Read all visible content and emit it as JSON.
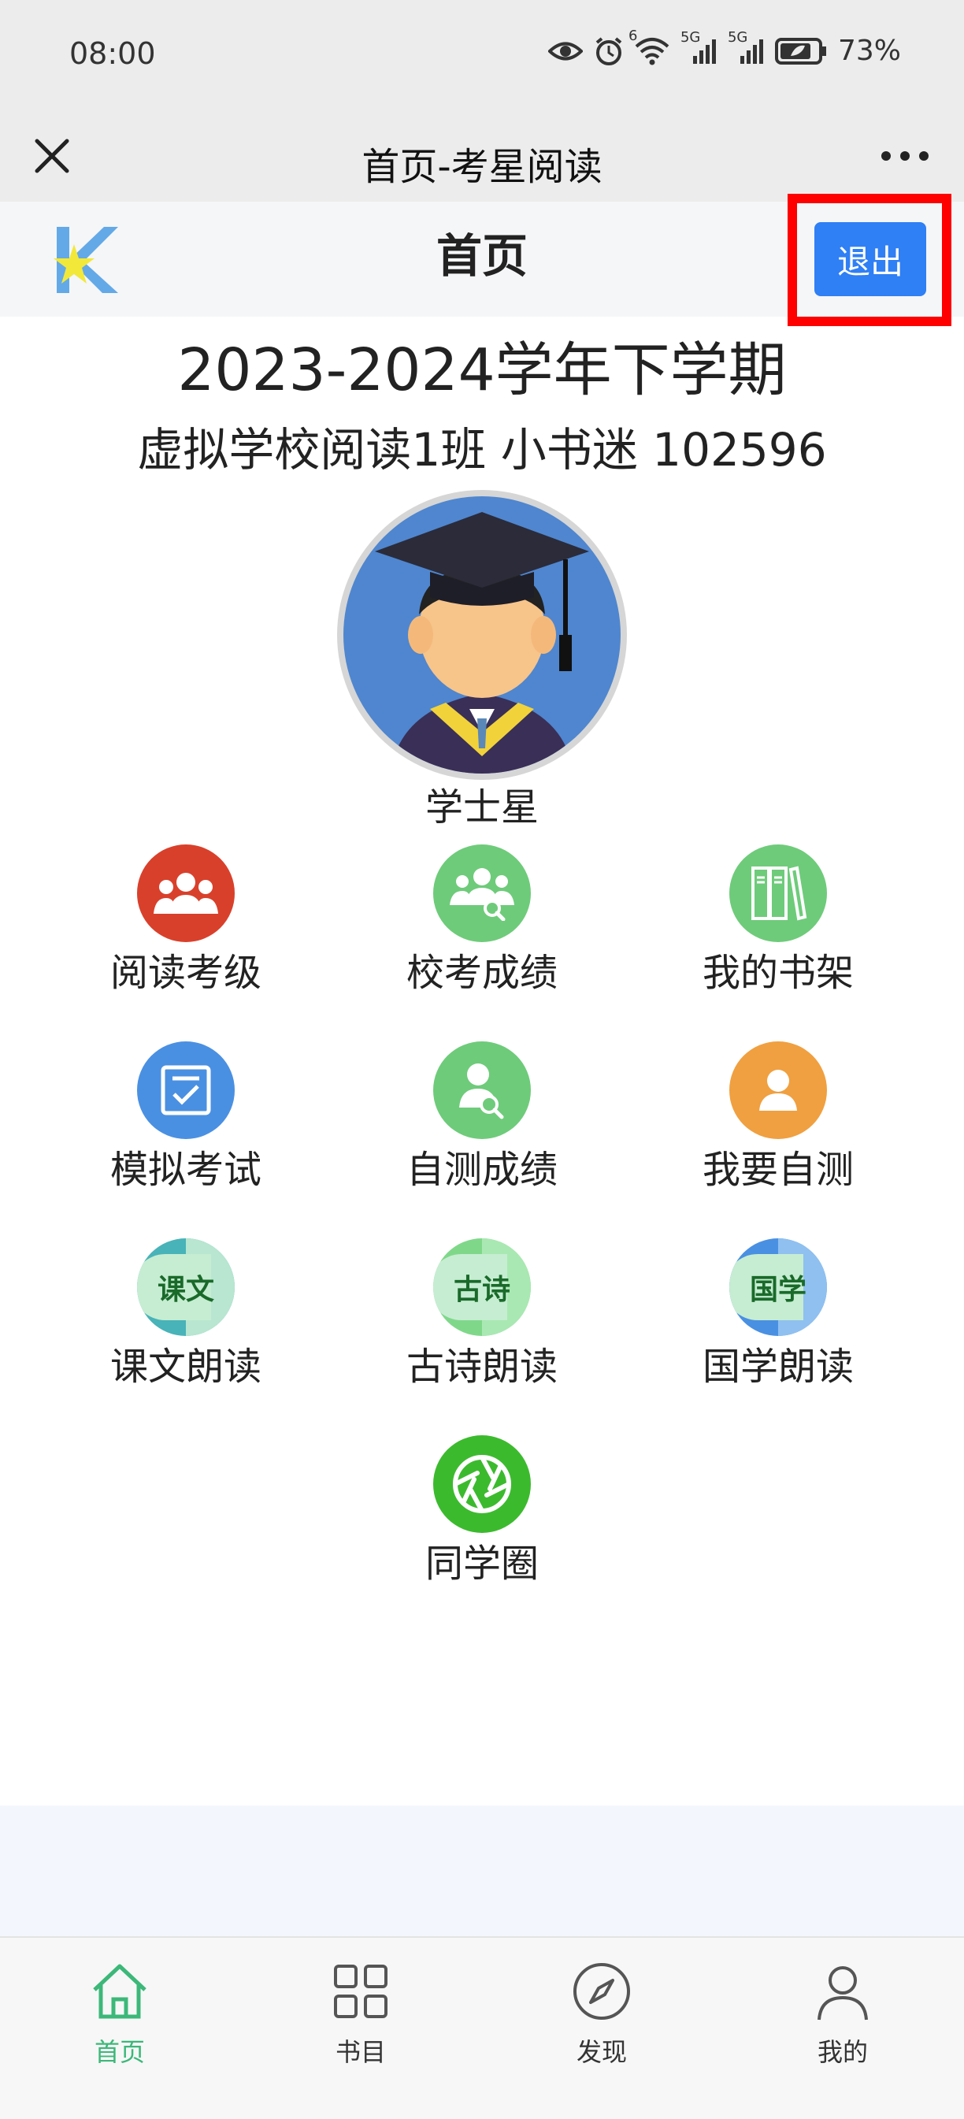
{
  "status": {
    "time": "08:00",
    "battery": "73%",
    "net1": "5G",
    "net2": "5G",
    "wifi_badge": "6"
  },
  "wechat": {
    "title": "首页-考星阅读"
  },
  "header": {
    "title": "首页",
    "logout_label": "退出",
    "logo_letter": "K"
  },
  "term": "2023-2024学年下学期",
  "class_info": "虚拟学校阅读1班 小书迷 102596",
  "rank_label": "学士星",
  "grid": [
    {
      "label": "阅读考级",
      "icon": "group-icon",
      "color": "#d9402b"
    },
    {
      "label": "校考成绩",
      "icon": "group-search-icon",
      "color": "#6ecb7a"
    },
    {
      "label": "我的书架",
      "icon": "bookshelf-icon",
      "color": "#6ecb7a"
    },
    {
      "label": "模拟考试",
      "icon": "checklist-icon",
      "color": "#4a90e2"
    },
    {
      "label": "自测成绩",
      "icon": "person-search-icon",
      "color": "#6ecb7a"
    },
    {
      "label": "我要自测",
      "icon": "person-icon",
      "color": "#f0a040"
    },
    {
      "label": "课文朗读",
      "icon": "speaker-text-icon",
      "text": "课文",
      "color": "#48b3b8"
    },
    {
      "label": "古诗朗读",
      "icon": "speaker-text-icon",
      "text": "古诗",
      "color": "#7fd88a"
    },
    {
      "label": "国学朗读",
      "icon": "speaker-text-icon",
      "text": "国学",
      "color": "#4a90e2"
    },
    {
      "label": "同学圈",
      "icon": "aperture-icon",
      "color": "#3cba2e"
    }
  ],
  "tabs": [
    {
      "label": "首页",
      "icon": "home-icon",
      "active": true
    },
    {
      "label": "书目",
      "icon": "grid-icon",
      "active": false
    },
    {
      "label": "发现",
      "icon": "compass-icon",
      "active": false
    },
    {
      "label": "我的",
      "icon": "user-icon",
      "active": false
    }
  ],
  "colors": {
    "accent": "#2f7ff5",
    "tab_active": "#3cb879",
    "highlight_frame": "#ff0000"
  }
}
